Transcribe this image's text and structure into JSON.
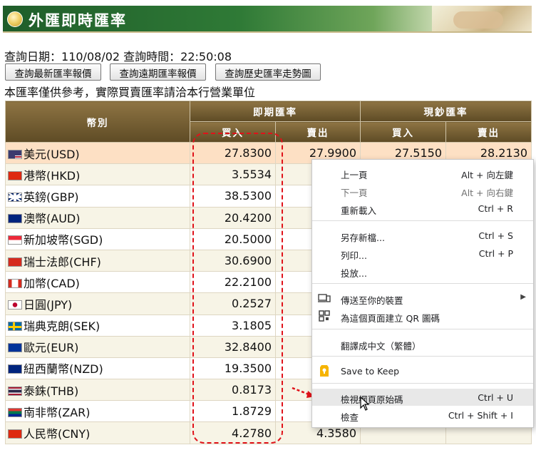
{
  "header": {
    "title": "外匯即時匯率"
  },
  "query": {
    "date_label": "查詢日期：",
    "date": "110/08/02",
    "time_label": "查詢時間：",
    "time": "22:50:08"
  },
  "buttons": {
    "latest": "查詢最新匯率報價",
    "forward": "查詢遠期匯率報價",
    "history": "查詢歷史匯率走勢圖"
  },
  "note": "本匯率僅供參考，實際買賣匯率請洽本行營業單位",
  "table": {
    "col_currency": "幣別",
    "col_spot": "即期匯率",
    "col_cash": "現鈔匯率",
    "col_buy": "買入",
    "col_sell": "賣出",
    "rows": [
      {
        "currency": "美元(USD)",
        "spot_buy": "27.8300",
        "spot_sell": "27.9900",
        "cash_buy": "27.5150",
        "cash_sell": "28.2130",
        "flag": "us-flag"
      },
      {
        "currency": "港幣(HKD)",
        "spot_buy": "3.5534",
        "spot_sell": "",
        "cash_buy": "",
        "cash_sell": "",
        "flag": "hk-flag"
      },
      {
        "currency": "英鎊(GBP)",
        "spot_buy": "38.5300",
        "spot_sell": "",
        "cash_buy": "",
        "cash_sell": "",
        "flag": "gb-flag"
      },
      {
        "currency": "澳幣(AUD)",
        "spot_buy": "20.4200",
        "spot_sell": "",
        "cash_buy": "",
        "cash_sell": "",
        "flag": "au-flag"
      },
      {
        "currency": "新加坡幣(SGD)",
        "spot_buy": "20.5000",
        "spot_sell": "",
        "cash_buy": "",
        "cash_sell": "",
        "flag": "sg-flag"
      },
      {
        "currency": "瑞士法郎(CHF)",
        "spot_buy": "30.6900",
        "spot_sell": "",
        "cash_buy": "",
        "cash_sell": "",
        "flag": "ch-flag"
      },
      {
        "currency": "加幣(CAD)",
        "spot_buy": "22.2100",
        "spot_sell": "",
        "cash_buy": "",
        "cash_sell": "",
        "flag": "ca-flag"
      },
      {
        "currency": "日圓(JPY)",
        "spot_buy": "0.2527",
        "spot_sell": "",
        "cash_buy": "",
        "cash_sell": "",
        "flag": "jp-flag"
      },
      {
        "currency": "瑞典克朗(SEK)",
        "spot_buy": "3.1805",
        "spot_sell": "",
        "cash_buy": "",
        "cash_sell": "",
        "flag": "se-flag"
      },
      {
        "currency": "歐元(EUR)",
        "spot_buy": "32.8400",
        "spot_sell": "",
        "cash_buy": "",
        "cash_sell": "",
        "flag": "eu-flag"
      },
      {
        "currency": "紐西蘭幣(NZD)",
        "spot_buy": "19.3500",
        "spot_sell": "",
        "cash_buy": "",
        "cash_sell": "",
        "flag": "nz-flag"
      },
      {
        "currency": "泰銖(THB)",
        "spot_buy": "0.8173",
        "spot_sell": "",
        "cash_buy": "",
        "cash_sell": "",
        "flag": "th-flag"
      },
      {
        "currency": "南非幣(ZAR)",
        "spot_buy": "1.8729",
        "spot_sell": "",
        "cash_buy": "",
        "cash_sell": "",
        "flag": "za-flag"
      },
      {
        "currency": "人民幣(CNY)",
        "spot_buy": "4.2780",
        "spot_sell": "4.3580",
        "cash_buy": "",
        "cash_sell": "",
        "flag": "cn-flag"
      }
    ]
  },
  "context_menu": {
    "items": [
      {
        "label": "上一頁",
        "shortcut": "Alt + 向左鍵",
        "disabled": false
      },
      {
        "label": "下一頁",
        "shortcut": "Alt + 向右鍵",
        "disabled": true
      },
      {
        "label": "重新載入",
        "shortcut": "Ctrl + R",
        "disabled": false
      },
      {
        "label": "另存新檔...",
        "shortcut": "Ctrl + S",
        "disabled": false
      },
      {
        "label": "列印...",
        "shortcut": "Ctrl + P",
        "disabled": false
      },
      {
        "label": "投放...",
        "shortcut": "",
        "disabled": false
      },
      {
        "label": "傳送至你的裝置",
        "shortcut": "",
        "icon": "devices-icon",
        "submenu": true
      },
      {
        "label": "為這個頁面建立 QR 圖碼",
        "shortcut": "",
        "icon": "qr-code-icon"
      },
      {
        "label": "翻譯成中文（繁體）",
        "shortcut": ""
      },
      {
        "label": "Save to Keep",
        "shortcut": "",
        "icon": "keep-icon"
      },
      {
        "label": "檢視網頁原始碼",
        "shortcut": "Ctrl + U",
        "highlighted": true
      },
      {
        "label": "檢查",
        "shortcut": "Ctrl + Shift + I"
      }
    ]
  },
  "colors": {
    "header_green": "#2f7a36",
    "table_header": "#6e5830",
    "annotation_red": "#e0121a",
    "row_highlight": "#fde0c4"
  }
}
